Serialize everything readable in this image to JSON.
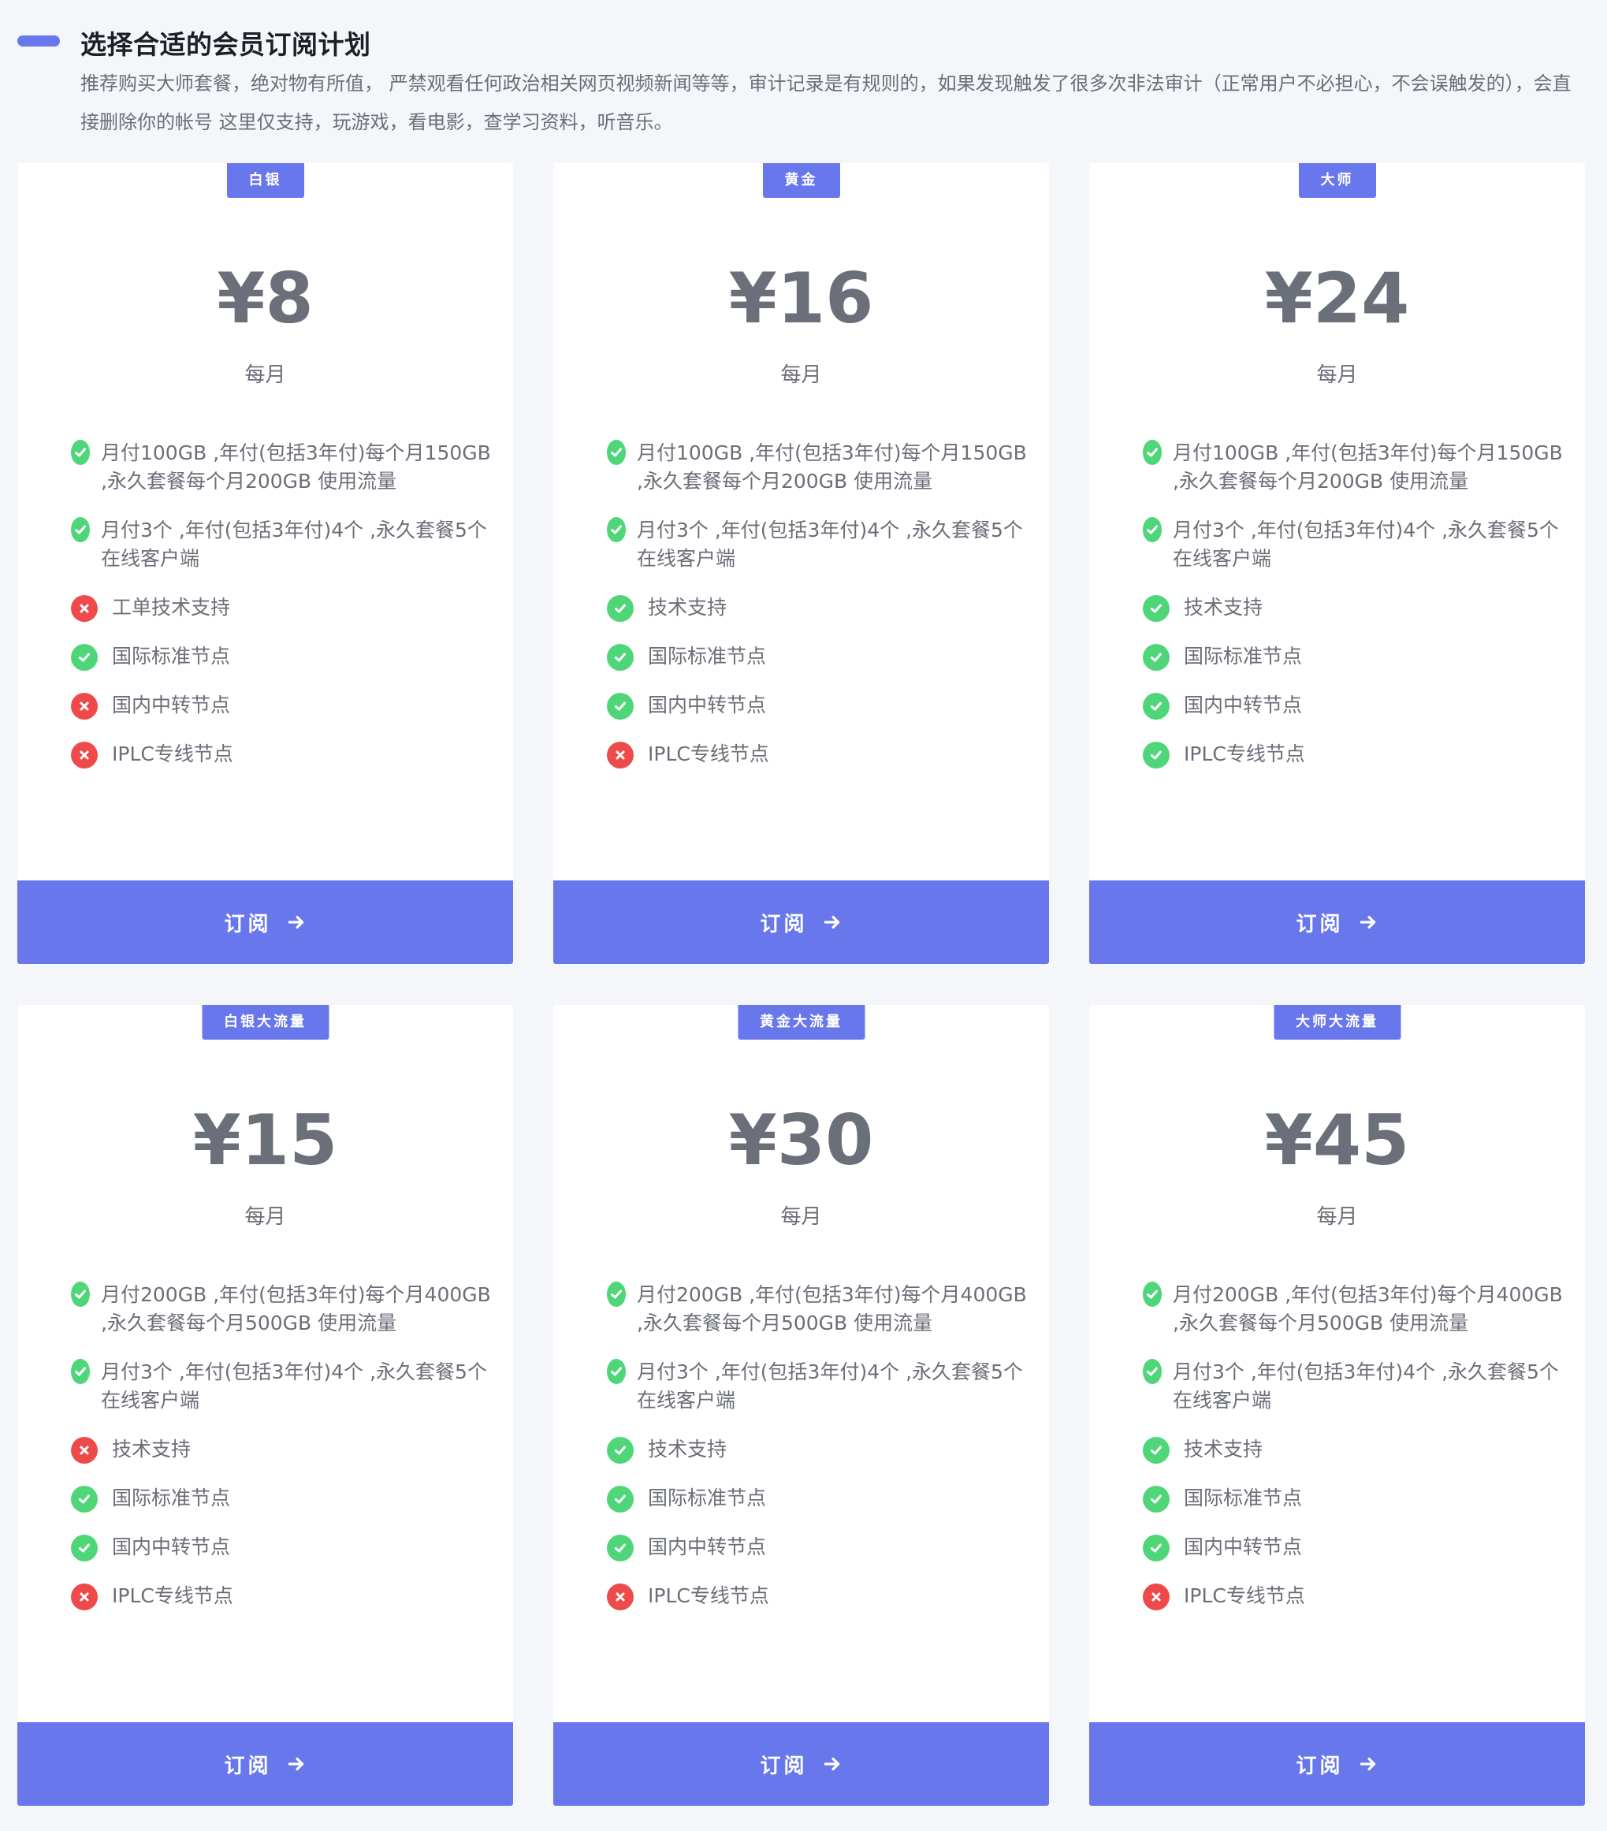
{
  "header": {
    "title": "选择合适的会员订阅计划",
    "description": "推荐购买大师套餐，绝对物有所值，  严禁观看任何政治相关网页视频新闻等等，审计记录是有规则的，如果发现触发了很多次非法审计（正常用户不必担心，不会误触发的），会直接删除你的帐号 这里仅支持，玩游戏，看电影，查学习资料，听音乐。"
  },
  "colors": {
    "accent": "#6877eb",
    "ok": "#4ed679",
    "no": "#ef4a4a"
  },
  "plans": [
    {
      "badge": "白银",
      "price": "¥8",
      "period": "每月",
      "button": "订阅",
      "features": [
        {
          "text": "月付100GB ,年付(包括3年付)每个月150GB ,永久套餐每个月200GB 使用流量",
          "ok": true,
          "icon": "check-icon"
        },
        {
          "text": "月付3个 ,年付(包括3年付)4个 ,永久套餐5个 在线客户端",
          "ok": true,
          "icon": "check-icon"
        },
        {
          "text": "工单技术支持",
          "ok": false,
          "icon": "cross-icon"
        },
        {
          "text": "国际标准节点",
          "ok": true,
          "icon": "check-icon"
        },
        {
          "text": "国内中转节点",
          "ok": false,
          "icon": "cross-icon"
        },
        {
          "text": "IPLC专线节点",
          "ok": false,
          "icon": "cross-icon"
        }
      ]
    },
    {
      "badge": "黄金",
      "price": "¥16",
      "period": "每月",
      "button": "订阅",
      "features": [
        {
          "text": "月付100GB ,年付(包括3年付)每个月150GB ,永久套餐每个月200GB 使用流量",
          "ok": true,
          "icon": "check-icon"
        },
        {
          "text": "月付3个 ,年付(包括3年付)4个 ,永久套餐5个 在线客户端",
          "ok": true,
          "icon": "check-icon"
        },
        {
          "text": "技术支持",
          "ok": true,
          "icon": "check-icon"
        },
        {
          "text": "国际标准节点",
          "ok": true,
          "icon": "check-icon"
        },
        {
          "text": "国内中转节点",
          "ok": true,
          "icon": "check-icon"
        },
        {
          "text": "IPLC专线节点",
          "ok": false,
          "icon": "cross-icon"
        }
      ]
    },
    {
      "badge": "大师",
      "price": "¥24",
      "period": "每月",
      "button": "订阅",
      "features": [
        {
          "text": "月付100GB ,年付(包括3年付)每个月150GB ,永久套餐每个月200GB 使用流量",
          "ok": true,
          "icon": "check-icon"
        },
        {
          "text": "月付3个 ,年付(包括3年付)4个 ,永久套餐5个 在线客户端",
          "ok": true,
          "icon": "check-icon"
        },
        {
          "text": "技术支持",
          "ok": true,
          "icon": "check-icon"
        },
        {
          "text": "国际标准节点",
          "ok": true,
          "icon": "check-icon"
        },
        {
          "text": "国内中转节点",
          "ok": true,
          "icon": "check-icon"
        },
        {
          "text": "IPLC专线节点",
          "ok": true,
          "icon": "check-icon"
        }
      ]
    },
    {
      "badge": "白银大流量",
      "price": "¥15",
      "period": "每月",
      "button": "订阅",
      "features": [
        {
          "text": "月付200GB ,年付(包括3年付)每个月400GB ,永久套餐每个月500GB 使用流量",
          "ok": true,
          "icon": "check-icon"
        },
        {
          "text": "月付3个 ,年付(包括3年付)4个 ,永久套餐5个 在线客户端",
          "ok": true,
          "icon": "check-icon"
        },
        {
          "text": "技术支持",
          "ok": false,
          "icon": "cross-icon"
        },
        {
          "text": "国际标准节点",
          "ok": true,
          "icon": "check-icon"
        },
        {
          "text": "国内中转节点",
          "ok": true,
          "icon": "check-icon"
        },
        {
          "text": "IPLC专线节点",
          "ok": false,
          "icon": "cross-icon"
        }
      ]
    },
    {
      "badge": "黄金大流量",
      "price": "¥30",
      "period": "每月",
      "button": "订阅",
      "features": [
        {
          "text": "月付200GB ,年付(包括3年付)每个月400GB ,永久套餐每个月500GB 使用流量",
          "ok": true,
          "icon": "check-icon"
        },
        {
          "text": "月付3个 ,年付(包括3年付)4个 ,永久套餐5个 在线客户端",
          "ok": true,
          "icon": "check-icon"
        },
        {
          "text": "技术支持",
          "ok": true,
          "icon": "check-icon"
        },
        {
          "text": "国际标准节点",
          "ok": true,
          "icon": "check-icon"
        },
        {
          "text": "国内中转节点",
          "ok": true,
          "icon": "check-icon"
        },
        {
          "text": "IPLC专线节点",
          "ok": false,
          "icon": "cross-icon"
        }
      ]
    },
    {
      "badge": "大师大流量",
      "price": "¥45",
      "period": "每月",
      "button": "订阅",
      "features": [
        {
          "text": "月付200GB ,年付(包括3年付)每个月400GB ,永久套餐每个月500GB 使用流量",
          "ok": true,
          "icon": "check-icon"
        },
        {
          "text": "月付3个 ,年付(包括3年付)4个 ,永久套餐5个 在线客户端",
          "ok": true,
          "icon": "check-icon"
        },
        {
          "text": "技术支持",
          "ok": true,
          "icon": "check-icon"
        },
        {
          "text": "国际标准节点",
          "ok": true,
          "icon": "check-icon"
        },
        {
          "text": "国内中转节点",
          "ok": true,
          "icon": "check-icon"
        },
        {
          "text": "IPLC专线节点",
          "ok": false,
          "icon": "cross-icon"
        }
      ]
    }
  ]
}
